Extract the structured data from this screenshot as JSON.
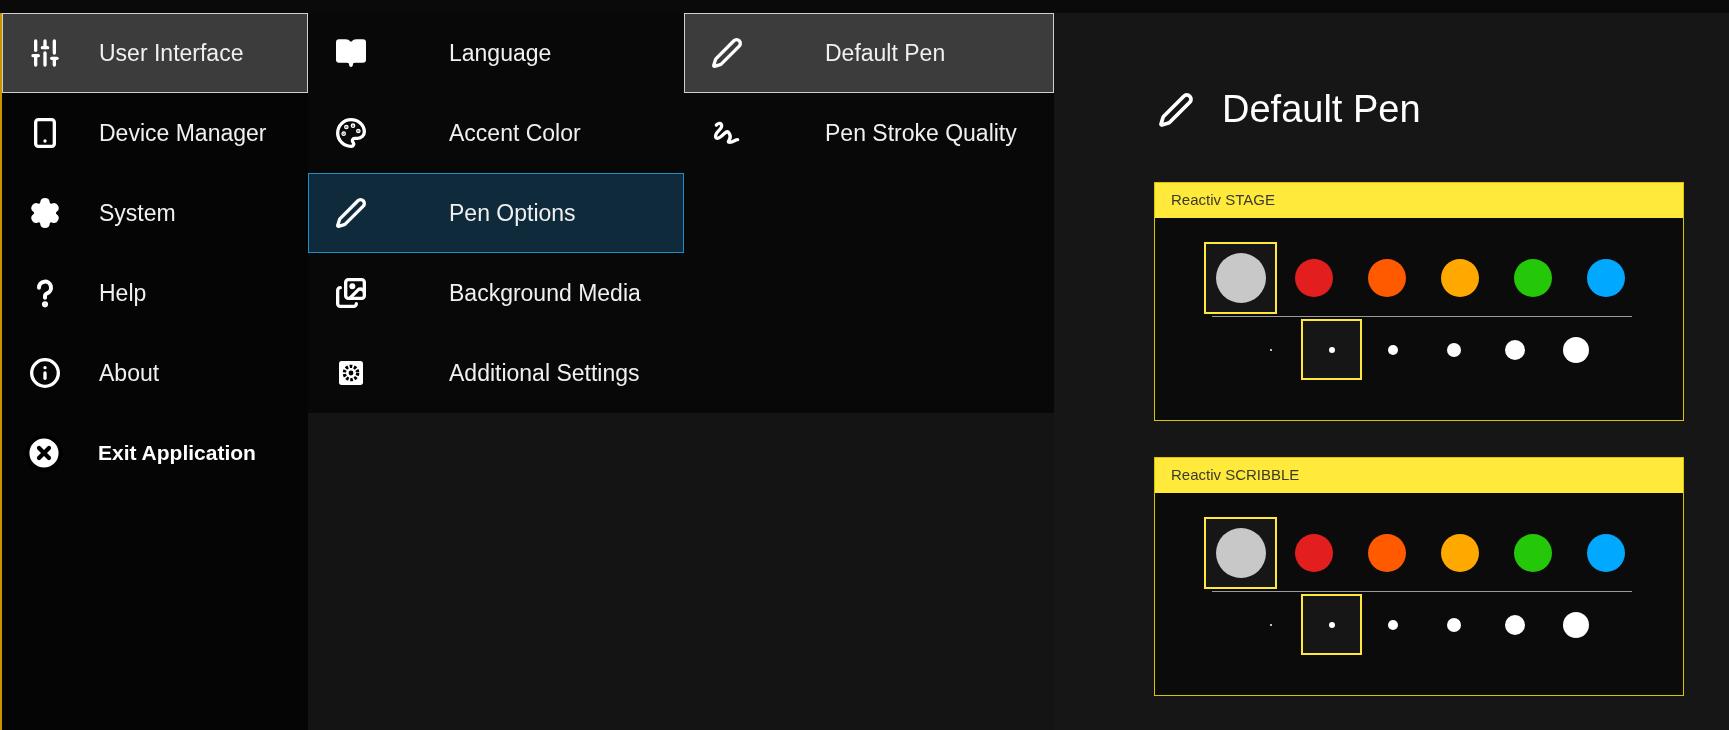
{
  "menu": {
    "items": [
      {
        "label": "User Interface",
        "selected": true
      },
      {
        "label": "Device Manager",
        "selected": false
      },
      {
        "label": "System",
        "selected": false
      },
      {
        "label": "Help",
        "selected": false
      },
      {
        "label": "About",
        "selected": false
      }
    ],
    "exit": {
      "label": "Exit Application"
    }
  },
  "submenu": {
    "items": [
      {
        "label": "Language",
        "selected": false
      },
      {
        "label": "Accent Color",
        "selected": false
      },
      {
        "label": "Pen Options",
        "selected": true
      },
      {
        "label": "Background Media",
        "selected": false
      },
      {
        "label": "Additional Settings",
        "selected": false
      }
    ]
  },
  "pen_menu": {
    "items": [
      {
        "label": "Default Pen",
        "selected": true
      },
      {
        "label": "Pen Stroke Quality",
        "selected": false
      }
    ]
  },
  "panel": {
    "title": "Default Pen",
    "pens": [
      {
        "title": "Reactiv STAGE",
        "colors": [
          {
            "color": "#c8c8c8",
            "selected": true
          },
          {
            "color": "#e31e1e",
            "selected": false
          },
          {
            "color": "#ff5a00",
            "selected": false
          },
          {
            "color": "#ffa800",
            "selected": false
          },
          {
            "color": "#24c808",
            "selected": false
          },
          {
            "color": "#00a8ff",
            "selected": false
          }
        ],
        "sizes": [
          {
            "selected": false
          },
          {
            "selected": true
          },
          {
            "selected": false
          },
          {
            "selected": false
          },
          {
            "selected": false
          },
          {
            "selected": false
          }
        ]
      },
      {
        "title": "Reactiv SCRIBBLE",
        "colors": [
          {
            "color": "#c8c8c8",
            "selected": true
          },
          {
            "color": "#e31e1e",
            "selected": false
          },
          {
            "color": "#ff5a00",
            "selected": false
          },
          {
            "color": "#ffa800",
            "selected": false
          },
          {
            "color": "#24c808",
            "selected": false
          },
          {
            "color": "#00a8ff",
            "selected": false
          }
        ],
        "sizes": [
          {
            "selected": false
          },
          {
            "selected": true
          },
          {
            "selected": false
          },
          {
            "selected": false
          },
          {
            "selected": false
          },
          {
            "selected": false
          }
        ]
      }
    ]
  }
}
